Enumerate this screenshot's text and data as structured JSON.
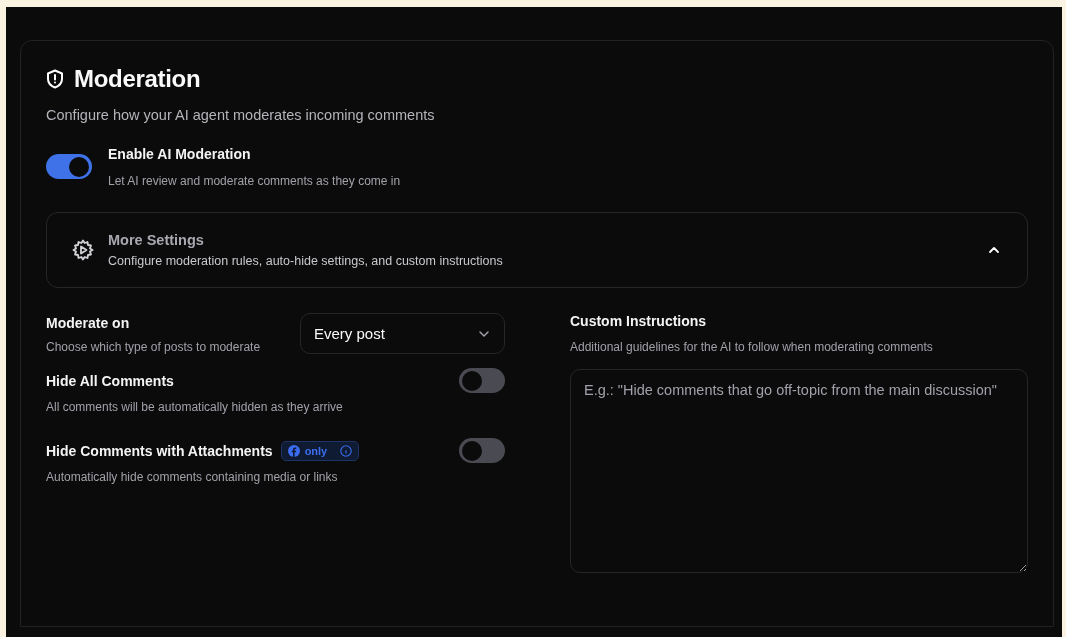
{
  "title": "Moderation",
  "subtitle": "Configure how your AI agent moderates incoming comments",
  "enable": {
    "label": "Enable AI Moderation",
    "description": "Let AI review and moderate comments as they come in",
    "on": true
  },
  "more_settings": {
    "title": "More Settings",
    "description": "Configure moderation rules, auto-hide settings, and custom instructions",
    "expanded": true
  },
  "moderate_on": {
    "label": "Moderate on",
    "description": "Choose which type of posts to moderate",
    "value": "Every post"
  },
  "options": [
    {
      "label": "Hide All Comments",
      "description": "All comments will be automatically hidden as they arrive",
      "on": false
    },
    {
      "label": "Hide Comments with Attachments",
      "badge": "only",
      "description": "Automatically hide comments containing media or links",
      "on": false
    }
  ],
  "custom_instructions": {
    "label": "Custom Instructions",
    "description": "Additional guidelines for the AI to follow when moderating comments",
    "placeholder": "E.g.: \"Hide comments that go off-topic from the main discussion\""
  }
}
